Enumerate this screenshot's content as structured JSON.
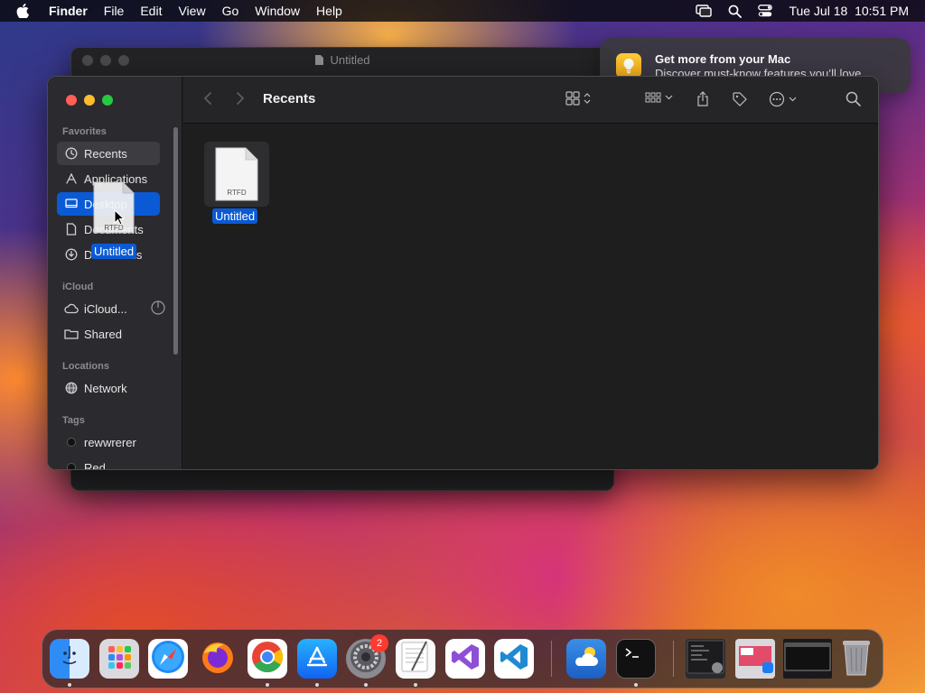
{
  "menubar": {
    "app_name": "Finder",
    "items": [
      "File",
      "Edit",
      "View",
      "Go",
      "Window",
      "Help"
    ],
    "datetime": "Tue Jul 18  10:51 PM"
  },
  "background_window": {
    "title": "Untitled"
  },
  "notification": {
    "title": "Get more from your Mac",
    "body": "Discover must-know features you’ll love."
  },
  "finder": {
    "toolbar_title": "Recents",
    "sidebar": {
      "favorites_heading": "Favorites",
      "favorites": [
        "Recents",
        "Applications",
        "Desktop",
        "Documents",
        "Downloads"
      ],
      "icloud_heading": "iCloud",
      "icloud": [
        "iCloud...",
        "Shared"
      ],
      "locations_heading": "Locations",
      "locations": [
        "Network"
      ],
      "tags_heading": "Tags",
      "tags": [
        "rewwrerer",
        "Red"
      ]
    },
    "files": [
      {
        "name": "Untitled",
        "type_label": "RTFD"
      }
    ]
  },
  "drag_ghost": {
    "type_label": "RTFD",
    "name": "Untitled"
  },
  "dock": {
    "apps": [
      "finder-icon",
      "launchpad-icon",
      "safari-icon",
      "firefox-icon",
      "chrome-icon",
      "app-store-icon",
      "system-settings-icon",
      "textedit-icon",
      "visual-studio-icon",
      "vscode-icon",
      "weather-icon",
      "terminal-icon"
    ],
    "settings_badge": "2"
  },
  "colors": {
    "selection": "#0a5ad6",
    "window_bg": "#1e1e1e",
    "sidebar_bg": "#2b2a2e"
  }
}
